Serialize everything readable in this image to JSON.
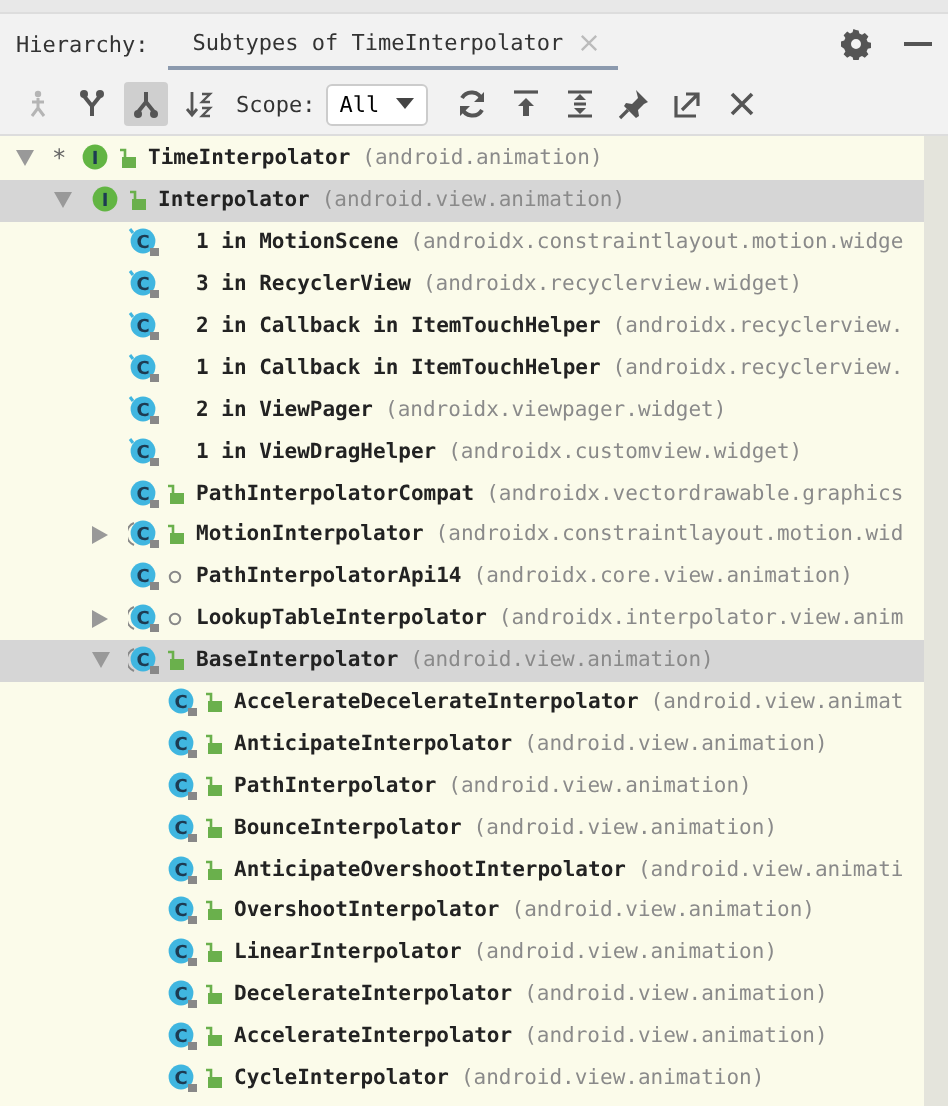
{
  "header": {
    "title": "Hierarchy:",
    "tabs": [
      {
        "label": "Subtypes of TimeInterpolator",
        "selected": true,
        "closable": true
      }
    ]
  },
  "toolbar": {
    "left_buttons": [
      {
        "kind": "caller",
        "selected": false,
        "disabled": true
      },
      {
        "kind": "supertypes",
        "selected": false,
        "disabled": false
      },
      {
        "kind": "subtypes",
        "selected": true,
        "disabled": false
      },
      {
        "kind": "sort",
        "selected": false,
        "disabled": false
      }
    ],
    "scope": {
      "label": "Scope:",
      "value": "All"
    },
    "right_buttons": [
      {
        "kind": "refresh",
        "selected": false,
        "disabled": false
      },
      {
        "kind": "export",
        "selected": false,
        "disabled": false
      },
      {
        "kind": "expand",
        "selected": false,
        "disabled": false
      },
      {
        "kind": "pin",
        "selected": false,
        "disabled": false
      },
      {
        "kind": "open",
        "selected": false,
        "disabled": false
      },
      {
        "kind": "close",
        "selected": false,
        "disabled": false
      }
    ]
  },
  "tree": [
    {
      "marker": "*",
      "kind": "interface",
      "letter": "I",
      "public": true,
      "name": "TimeInterpolator",
      "package": "(android.animation)",
      "expanded": true,
      "selected": false,
      "children": [
        {
          "kind": "interface",
          "letter": "I",
          "public": true,
          "name": "Interpolator",
          "package": "(android.view.animation)",
          "expanded": true,
          "selected": true,
          "children": [
            {
              "kind": "anonymous",
              "letter": "C",
              "name": "1 in MotionScene",
              "package": "(androidx.constraintlayout.motion.widge",
              "selected": false
            },
            {
              "kind": "anonymous",
              "letter": "C",
              "name": "3 in RecyclerView",
              "package": "(androidx.recyclerview.widget)",
              "selected": false
            },
            {
              "kind": "anonymous",
              "letter": "C",
              "name": "2 in Callback in ItemTouchHelper",
              "package": "(androidx.recyclerview.",
              "selected": false
            },
            {
              "kind": "anonymous",
              "letter": "C",
              "name": "1 in Callback in ItemTouchHelper",
              "package": "(androidx.recyclerview.",
              "selected": false
            },
            {
              "kind": "anonymous",
              "letter": "C",
              "name": "2 in ViewPager",
              "package": "(androidx.viewpager.widget)",
              "selected": false
            },
            {
              "kind": "anonymous",
              "letter": "C",
              "name": "1 in ViewDragHelper",
              "package": "(androidx.customview.widget)",
              "selected": false
            },
            {
              "kind": "class",
              "letter": "C",
              "public": true,
              "name": "PathInterpolatorCompat",
              "package": "(androidx.vectordrawable.graphics",
              "selected": false
            },
            {
              "kind": "abstract",
              "letter": "C",
              "public": true,
              "name": "MotionInterpolator",
              "package": "(androidx.constraintlayout.motion.wid",
              "expanded": false,
              "selected": false
            },
            {
              "kind": "class",
              "letter": "C",
              "public": false,
              "name": "PathInterpolatorApi14",
              "package": "(androidx.core.view.animation)",
              "selected": false
            },
            {
              "kind": "abstract",
              "letter": "C",
              "public": false,
              "name": "LookupTableInterpolator",
              "package": "(androidx.interpolator.view.anim",
              "expanded": false,
              "selected": false
            },
            {
              "kind": "abstract",
              "letter": "C",
              "public": true,
              "name": "BaseInterpolator",
              "package": "(android.view.animation)",
              "expanded": true,
              "selected": true,
              "children": [
                {
                  "kind": "class",
                  "letter": "C",
                  "public": true,
                  "name": "AccelerateDecelerateInterpolator",
                  "package": "(android.view.animat",
                  "selected": false
                },
                {
                  "kind": "class",
                  "letter": "C",
                  "public": true,
                  "name": "AnticipateInterpolator",
                  "package": "(android.view.animation)",
                  "selected": false
                },
                {
                  "kind": "class",
                  "letter": "C",
                  "public": true,
                  "name": "PathInterpolator",
                  "package": "(android.view.animation)",
                  "selected": false
                },
                {
                  "kind": "class",
                  "letter": "C",
                  "public": true,
                  "name": "BounceInterpolator",
                  "package": "(android.view.animation)",
                  "selected": false
                },
                {
                  "kind": "class",
                  "letter": "C",
                  "public": true,
                  "name": "AnticipateOvershootInterpolator",
                  "package": "(android.view.animati",
                  "selected": false
                },
                {
                  "kind": "class",
                  "letter": "C",
                  "public": true,
                  "name": "OvershootInterpolator",
                  "package": "(android.view.animation)",
                  "selected": false
                },
                {
                  "kind": "class",
                  "letter": "C",
                  "public": true,
                  "name": "LinearInterpolator",
                  "package": "(android.view.animation)",
                  "selected": false
                },
                {
                  "kind": "class",
                  "letter": "C",
                  "public": true,
                  "name": "DecelerateInterpolator",
                  "package": "(android.view.animation)",
                  "selected": false
                },
                {
                  "kind": "class",
                  "letter": "C",
                  "public": true,
                  "name": "AccelerateInterpolator",
                  "package": "(android.view.animation)",
                  "selected": false
                },
                {
                  "kind": "class",
                  "letter": "C",
                  "public": true,
                  "name": "CycleInterpolator",
                  "package": "(android.view.animation)",
                  "selected": false
                }
              ]
            }
          ]
        }
      ]
    }
  ]
}
